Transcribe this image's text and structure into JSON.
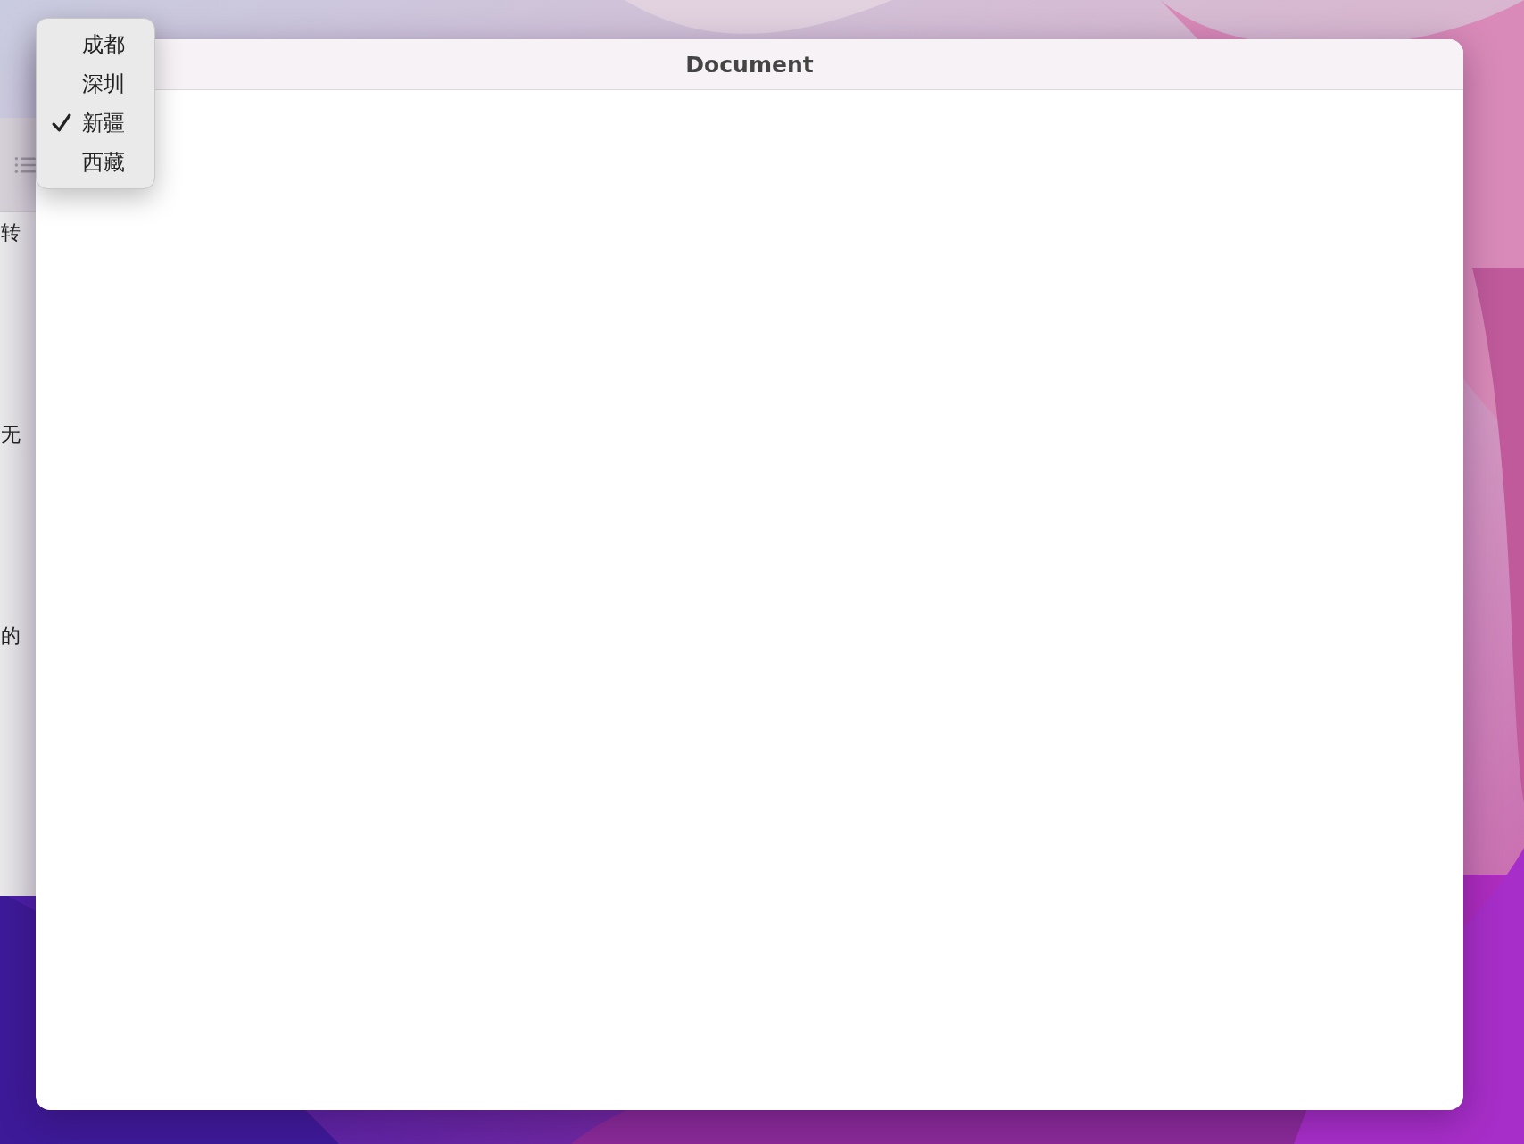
{
  "background_window": {
    "texts": [
      "转",
      "无",
      "的"
    ]
  },
  "window": {
    "title": "Document"
  },
  "popup_menu": {
    "items": [
      {
        "label": "成都",
        "selected": false
      },
      {
        "label": "深圳",
        "selected": false
      },
      {
        "label": "新疆",
        "selected": true
      },
      {
        "label": "西藏",
        "selected": false
      }
    ]
  }
}
